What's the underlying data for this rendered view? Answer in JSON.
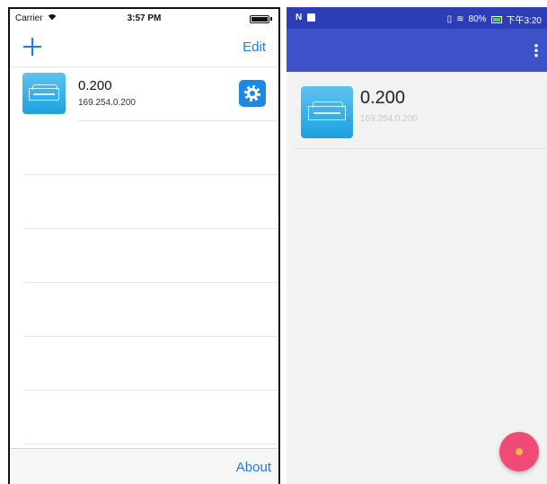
{
  "ios": {
    "status": {
      "carrier": "Carrier",
      "time": "3:57 PM"
    },
    "nav": {
      "add_icon": "plus-icon",
      "edit_label": "Edit"
    },
    "device": {
      "name": "0.200",
      "ip": "169.254.0.200",
      "icon": "device-icon",
      "settings_icon": "gear-icon"
    },
    "toolbar": {
      "about_label": "About"
    },
    "colors": {
      "accent": "#1e7cf2",
      "settings_bg": "#1e88e5"
    }
  },
  "android": {
    "status": {
      "left_icons": "N",
      "battery": "80%",
      "time": "下午3:20"
    },
    "appbar": {
      "menu_icon": "overflow-menu-icon"
    },
    "device": {
      "name": "0.200",
      "ip": "169.254.0.200",
      "icon": "device-icon"
    },
    "fab": {
      "icon": "add-fab-icon"
    },
    "colors": {
      "status_bar": "#2c3db8",
      "app_bar": "#3d52c8",
      "fab": "#f04a77"
    }
  }
}
